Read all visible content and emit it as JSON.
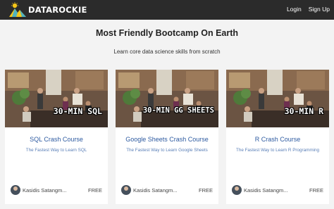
{
  "nav": {
    "brand": "DATAROCKIE",
    "login": "Login",
    "signup": "Sign Up"
  },
  "hero": {
    "title": "Most Friendly Bootcamp On Earth",
    "subtitle": "Learn core data science skills from scratch"
  },
  "courses": [
    {
      "thumb_label": "30-MIN SQL",
      "title": "SQL Crash Course",
      "description": "The Fastest Way to Learn SQL",
      "author": "Kasidis Satangm...",
      "price": "FREE"
    },
    {
      "thumb_label": "30-MIN GG SHEETS",
      "title": "Google Sheets Crash Course",
      "description": "The Fastest Way to Learn Google Sheets",
      "author": "Kasidis Satangm...",
      "price": "FREE"
    },
    {
      "thumb_label": "30-MIN R",
      "title": "R Crash Course",
      "description": "The Fastest Way to Learn R Programming",
      "author": "Kasidis Satangm...",
      "price": "FREE"
    }
  ],
  "colors": {
    "navbar": "#2b2b2b",
    "page_bg": "#f3f3f3",
    "card_title": "#2d5aa0",
    "card_desc": "#5a7fb7",
    "logo_yellow": "#f5c518",
    "logo_teal": "#4fb3bf"
  }
}
